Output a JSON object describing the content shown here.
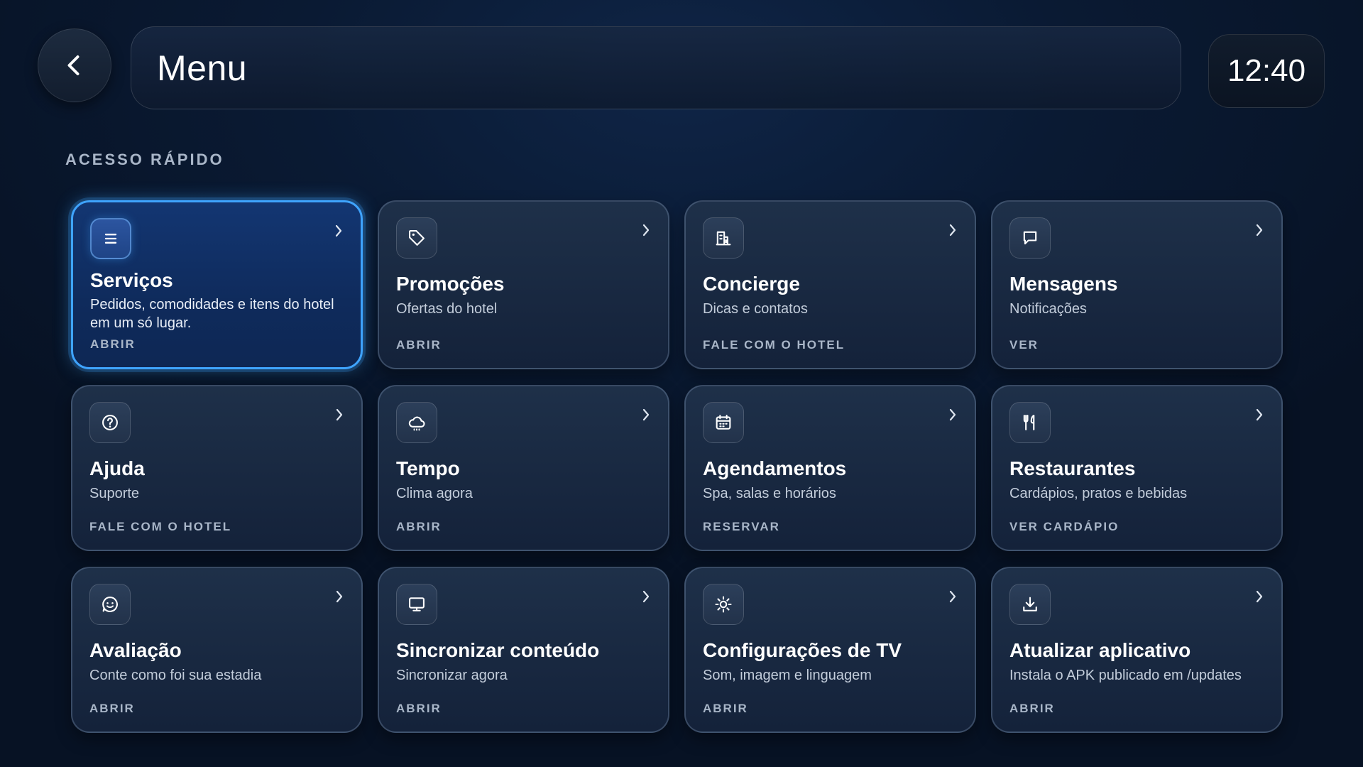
{
  "header": {
    "title": "Menu",
    "clock": "12:40",
    "back_icon": "chevron-left-icon"
  },
  "quick_access": {
    "label": "ACESSO RÁPIDO",
    "cards": [
      {
        "title": "Serviços",
        "subtitle": "Pedidos, comodidades e itens do hotel em um só lugar.",
        "action": "ABRIR",
        "icon": "list-icon",
        "selected": true
      },
      {
        "title": "Promoções",
        "subtitle": "Ofertas do hotel",
        "action": "ABRIR",
        "icon": "tag-icon"
      },
      {
        "title": "Concierge",
        "subtitle": "Dicas e contatos",
        "action": "FALE COM O HOTEL",
        "icon": "concierge-icon"
      },
      {
        "title": "Mensagens",
        "subtitle": "Notificações",
        "action": "VER",
        "icon": "message-icon"
      },
      {
        "title": "Ajuda",
        "subtitle": "Suporte",
        "action": "FALE COM O HOTEL",
        "icon": "help-icon"
      },
      {
        "title": "Tempo",
        "subtitle": "Clima agora",
        "action": "ABRIR",
        "icon": "cloud-icon"
      },
      {
        "title": "Agendamentos",
        "subtitle": "Spa, salas e horários",
        "action": "RESERVAR",
        "icon": "calendar-icon"
      },
      {
        "title": "Restaurantes",
        "subtitle": "Cardápios, pratos e bebidas",
        "action": "VER CARDÁPIO",
        "icon": "utensils-icon"
      },
      {
        "title": "Avaliação",
        "subtitle": "Conte como foi sua estadia",
        "action": "ABRIR",
        "icon": "smile-icon"
      },
      {
        "title": "Sincronizar conteúdo",
        "subtitle": "Sincronizar agora",
        "action": "ABRIR",
        "icon": "monitor-icon"
      },
      {
        "title": "Configurações de TV",
        "subtitle": "Som, imagem e linguagem",
        "action": "ABRIR",
        "icon": "sun-icon"
      },
      {
        "title": "Atualizar aplicativo",
        "subtitle": "Instala o APK publicado em /updates",
        "action": "ABRIR",
        "icon": "download-icon"
      }
    ]
  },
  "colors": {
    "accent": "#3fa4ff",
    "background": "#0a1a33",
    "card": "#1a2a42"
  }
}
